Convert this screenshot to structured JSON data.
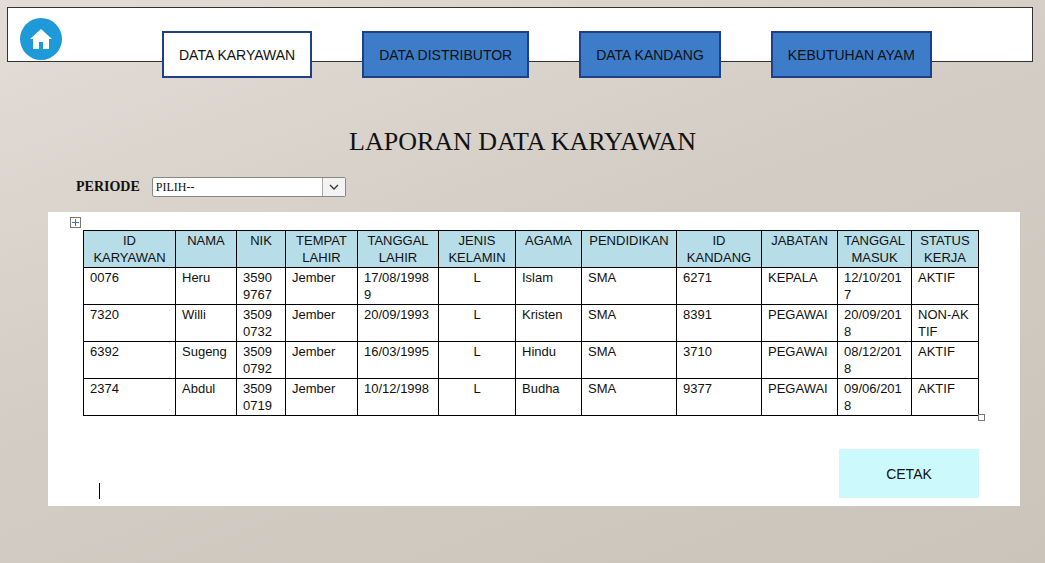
{
  "nav": {
    "tabs": [
      {
        "label": "DATA KARYAWAN",
        "selected": true
      },
      {
        "label": "DATA DISTRIBUTOR",
        "selected": false
      },
      {
        "label": "DATA KANDANG",
        "selected": false
      },
      {
        "label": "KEBUTUHAN AYAM",
        "selected": false
      }
    ]
  },
  "title": "LAPORAN DATA KARYAWAN",
  "filter": {
    "label": "PERIODE",
    "value": "PILIH--"
  },
  "table": {
    "columns": [
      "ID KARYAWAN",
      "NAMA",
      "NIK",
      "TEMPAT LAHIR",
      "TANGGAL LAHIR",
      "JENIS KELAMIN",
      "AGAMA",
      "PENDIDIKAN",
      "ID KANDANG",
      "JABATAN",
      "TANGGAL MASUK",
      "STATUS KERJA"
    ],
    "rows": [
      [
        "0076",
        "Heru",
        "35909767",
        "Jember",
        "17/08/19989",
        "L",
        "Islam",
        "SMA",
        "6271",
        "KEPALA",
        "12/10/2017",
        "AKTIF"
      ],
      [
        "7320",
        "Willi",
        "35090732",
        "Jember",
        "20/09/1993",
        "L",
        "Kristen",
        "SMA",
        "8391",
        "PEGAWAI",
        "20/09/2018",
        "NON-AKTIF"
      ],
      [
        "6392",
        "Sugeng",
        "35090792",
        "Jember",
        "16/03/1995",
        "L",
        "Hindu",
        "SMA",
        "3710",
        "PEGAWAI",
        "08/12/2018",
        "AKTIF"
      ],
      [
        "2374",
        "Abdul",
        "35090719",
        "Jember",
        "10/12/1998",
        "L",
        "Budha",
        "SMA",
        "9377",
        "PEGAWAI",
        "09/06/2018",
        "AKTIF"
      ]
    ]
  },
  "buttons": [
    "CETAK"
  ]
}
